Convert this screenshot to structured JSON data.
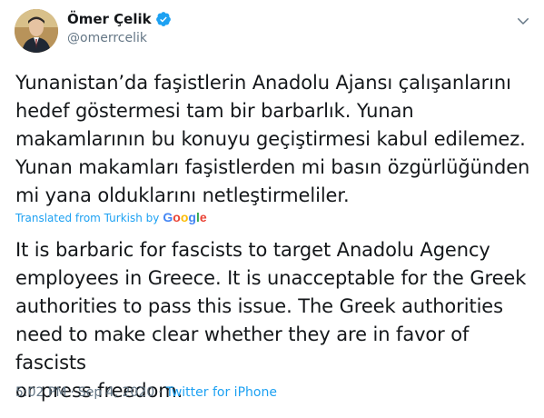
{
  "author": {
    "name": "Ömer Çelik",
    "handle": "@omerrcelik",
    "verified": true
  },
  "tweet": {
    "text": "Yunanistan’da faşistlerin Anadolu Ajansı çalışanlarını\nhedef göstermesi tam bir barbarlık. Yunan\nmakamlarının bu konuyu geçiştirmesi kabul edilemez.\nYunan makamları faşistlerden mi basın özgürlüğünden\nmi yana olduklarını netleştirmeliler.",
    "translation_label": "Translated from Turkish by",
    "translation_provider": "Google",
    "translated_text": "It is barbaric for fascists to target Anadolu Agency\nemployees in Greece. It is unacceptable for the Greek\nauthorities to pass this issue. The Greek authorities\nneed to make clear whether they are in favor of fascists\nor press freedom.",
    "time": "5:02 PM",
    "separator": "·",
    "date": "Sep 4, 2020",
    "source": "Twitter for iPhone"
  },
  "icons": {
    "verified": "verified-badge-icon",
    "menu": "chevron-down-icon"
  },
  "colors": {
    "accent": "#1da1f2",
    "secondary_text": "#657786",
    "primary_text": "#14171a"
  }
}
